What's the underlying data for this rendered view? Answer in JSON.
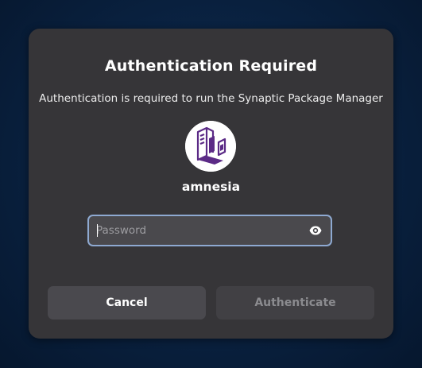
{
  "dialog": {
    "title": "Authentication Required",
    "message": "Authentication is required to run the Synaptic Package Manager",
    "user": {
      "avatar_icon": "synaptic-package-manager-icon",
      "username": "amnesia"
    },
    "password_field": {
      "value": "",
      "placeholder": "Password",
      "reveal_icon": "eye-icon"
    },
    "buttons": {
      "cancel_label": "Cancel",
      "authenticate_label": "Authenticate"
    }
  },
  "colors": {
    "background": "#0a2343",
    "dialog_bg": "#363538",
    "focus_ring": "#8ea9d1",
    "avatar_accent": "#5b2a86"
  }
}
